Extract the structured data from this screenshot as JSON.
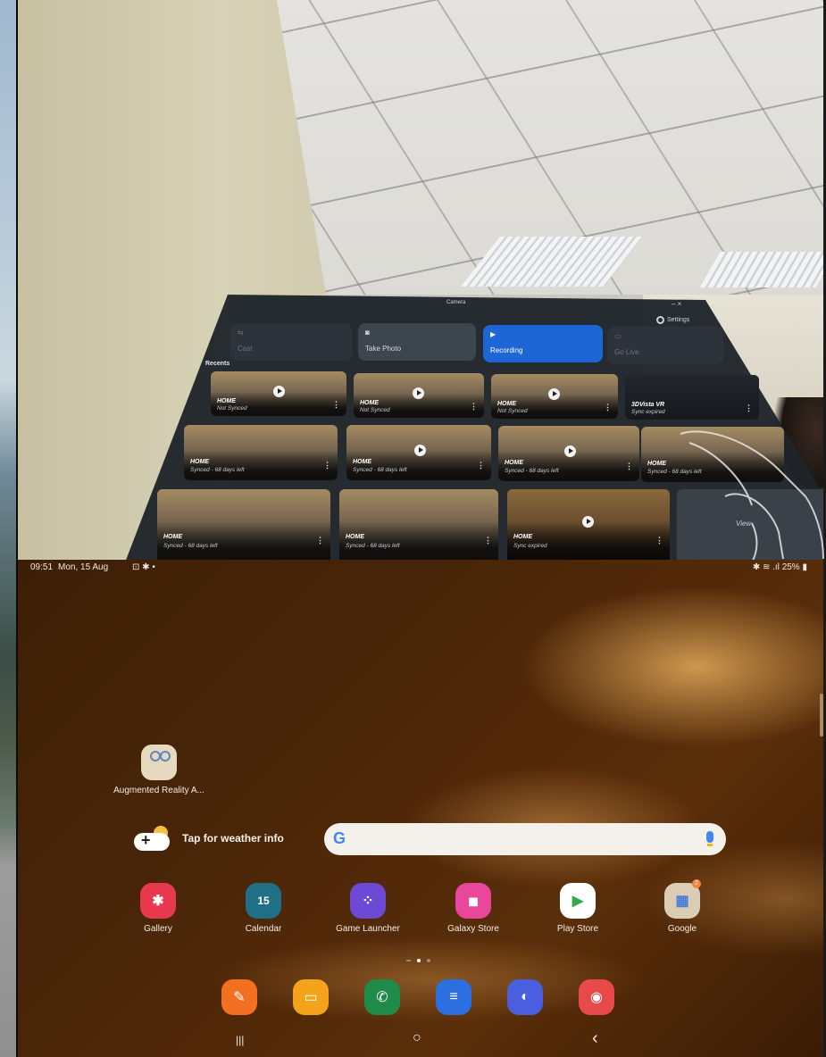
{
  "camera_panel": {
    "title": "Camera",
    "settings_label": "Settings",
    "window_controls": "–  ×",
    "modes": [
      {
        "label": "Cast",
        "icon": "cast-icon",
        "state": "disabled"
      },
      {
        "label": "Take Photo",
        "icon": "camera-icon",
        "state": "normal"
      },
      {
        "label": "Recording",
        "icon": "video-icon",
        "state": "active"
      },
      {
        "label": "Go Live",
        "icon": "live-icon",
        "state": "disabled"
      }
    ],
    "recents_label": "Recents",
    "recents": [
      {
        "name": "HOME",
        "status": "Not Synced"
      },
      {
        "name": "HOME",
        "status": "Not Synced"
      },
      {
        "name": "HOME",
        "status": "Not Synced"
      },
      {
        "name": "3DVista VR",
        "status": "Sync expired"
      },
      {
        "name": "HOME",
        "status": "Synced - 68 days left"
      },
      {
        "name": "HOME",
        "status": "Synced - 68 days left"
      },
      {
        "name": "HOME",
        "status": "Synced - 68 days left"
      },
      {
        "name": "HOME",
        "status": "Synced - 68 days left"
      },
      {
        "name": "HOME",
        "status": "Synced - 68 days left"
      },
      {
        "name": "HOME",
        "status": "Synced - 68 days left"
      },
      {
        "name": "HOME",
        "status": "Sync expired"
      },
      {
        "name": "",
        "status": "View"
      }
    ]
  },
  "statusbar": {
    "time": "09:51",
    "date": "Mon, 15 Aug",
    "icons": "⊡ ✱ •",
    "battery": "25%",
    "right_icons": "✱ ≋ .ıl"
  },
  "home": {
    "ar_app_label": "Augmented Reality A...",
    "weather_label": "Tap for weather info",
    "search_logo": "G",
    "apps": [
      {
        "label": "Gallery",
        "icon": "gallery-icon",
        "color": "#e8384d",
        "glyph": "✱"
      },
      {
        "label": "Calendar",
        "icon": "calendar-icon",
        "color": "#1f6f86",
        "glyph": "15"
      },
      {
        "label": "Game Launcher",
        "icon": "game-launcher-icon",
        "color": "#6d4ad6",
        "glyph": "⁘"
      },
      {
        "label": "Galaxy Store",
        "icon": "galaxy-store-icon",
        "color": "#e9479a",
        "glyph": "◼"
      },
      {
        "label": "Play Store",
        "icon": "play-store-icon",
        "color": "#ffffff",
        "glyph": "▶"
      },
      {
        "label": "Google",
        "icon": "google-folder-icon",
        "color": "#d9cdb6",
        "glyph": "▦",
        "badge": "2"
      }
    ],
    "dock": [
      {
        "icon": "notes-icon",
        "color": "#f36f22",
        "glyph": "✎"
      },
      {
        "icon": "folder-icon",
        "color": "#f5a31a",
        "glyph": "▭"
      },
      {
        "icon": "phone-icon",
        "color": "#1f8a4a",
        "glyph": "✆"
      },
      {
        "icon": "messages-icon",
        "color": "#2b6fe0",
        "glyph": "≡"
      },
      {
        "icon": "internet-icon",
        "color": "#4a5fe0",
        "glyph": "◐"
      },
      {
        "icon": "screen-recorder-icon",
        "color": "#e84a4a",
        "glyph": "◉"
      }
    ],
    "nav": {
      "recents": "|||",
      "home": "○",
      "back": "‹"
    }
  }
}
